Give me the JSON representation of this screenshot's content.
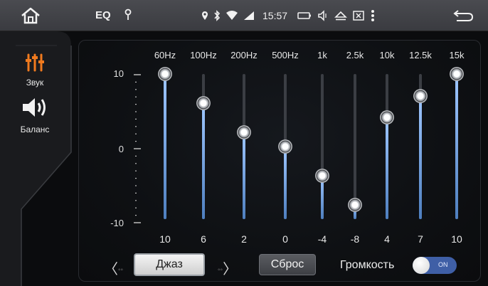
{
  "statusbar": {
    "eq_label": "EQ",
    "time": "15:57",
    "icons": [
      "home-icon",
      "location-pin-icon",
      "bluetooth-icon",
      "wifi-icon",
      "signal-icon",
      "battery-icon",
      "volume-icon",
      "eject-icon",
      "close-box-icon",
      "more-vert-icon",
      "back-icon"
    ]
  },
  "side": {
    "items": [
      {
        "label": "Звук",
        "icon": "equalizer-icon"
      },
      {
        "label": "Баланс",
        "icon": "speaker-icon"
      }
    ]
  },
  "scale": {
    "top": "10",
    "mid": "0",
    "bottom": "-10"
  },
  "bands": [
    {
      "freq": "60Hz",
      "value": "10",
      "level": 10
    },
    {
      "freq": "100Hz",
      "value": "6",
      "level": 6
    },
    {
      "freq": "200Hz",
      "value": "2",
      "level": 2
    },
    {
      "freq": "500Hz",
      "value": "0",
      "level": 0
    },
    {
      "freq": "1k",
      "value": "-4",
      "level": -4
    },
    {
      "freq": "2.5k",
      "value": "-8",
      "level": -8
    },
    {
      "freq": "10k",
      "value": "4",
      "level": 4
    },
    {
      "freq": "12.5k",
      "value": "7",
      "level": 7
    },
    {
      "freq": "15k",
      "value": "10",
      "level": 10
    }
  ],
  "controls": {
    "prev_arrow": "〈",
    "next_arrow": "〉",
    "arrow_dots": "◦◦",
    "preset": "Джаз",
    "reset": "Сброс",
    "volume_label": "Громкость",
    "toggle_text": "ON",
    "toggle_on": true
  },
  "colors": {
    "accent_orange": "#f07a1e",
    "toggle_blue": "#3f5fa6",
    "fill_blue": "#7fb2f0"
  }
}
